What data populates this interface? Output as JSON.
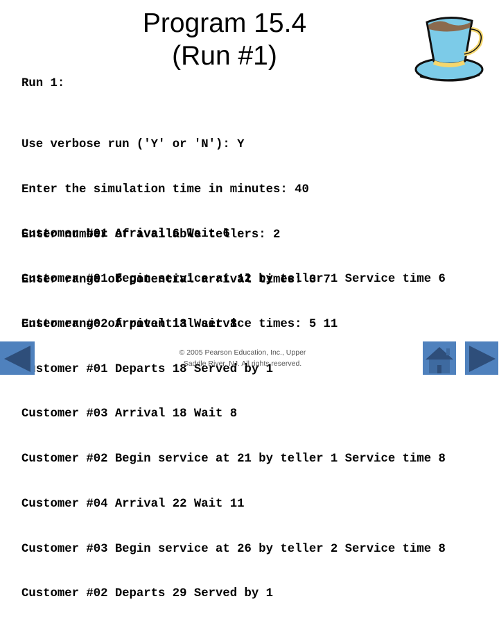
{
  "slide": {
    "title_line1": "Program 15.4",
    "title_line2": "(Run #1)",
    "run_label": "Run 1:",
    "prompts": [
      "Use verbose run ('Y' or 'N'): Y",
      "Enter the simulation time in minutes: 40",
      "Enter number of available tellers: 2",
      "Enter range of potential arrival times: 3 7",
      "Enter range of potential service times: 5 11"
    ],
    "log": [
      "Customer #01 Arrival 6 Wait 6",
      "Customer #01 Begin service at 12 by teller 1 Service time 6",
      "Customer #02 Arrival 13 Wait 8",
      "Customer #01 Departs 18 Served by 1",
      "Customer #03 Arrival 18 Wait 8",
      "Customer #02 Begin service at 21 by teller 1 Service time 8",
      "Customer #04 Arrival 22 Wait 11",
      "Customer #03 Begin service at 26 by teller 2 Service time 8",
      "Customer #02 Departs 29 Served by 1"
    ],
    "footer_line1": "© 2005 Pearson Education, Inc., Upper",
    "footer_line2": "Saddle River, NJ.  All rights reserved."
  },
  "navigation": {
    "previous_icon": "left-triangle-icon",
    "home_icon": "home-icon",
    "next_icon": "right-triangle-icon"
  },
  "colors": {
    "nav_button": "#4f81bd",
    "nav_glyph": "#2e4e7a",
    "cup": "#7ccbe8",
    "coffee": "#8b6a4e",
    "accent": "#f5d76e"
  }
}
